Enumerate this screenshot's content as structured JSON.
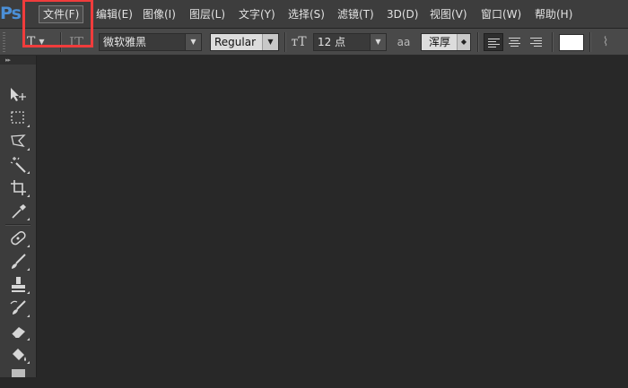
{
  "app": {
    "logo": "Ps"
  },
  "menubar": {
    "items": [
      {
        "label": "文件(F)"
      },
      {
        "label": "编辑(E)"
      },
      {
        "label": "图像(I)"
      },
      {
        "label": "图层(L)"
      },
      {
        "label": "文字(Y)"
      },
      {
        "label": "选择(S)"
      },
      {
        "label": "滤镜(T)"
      },
      {
        "label": "3D(D)"
      },
      {
        "label": "视图(V)"
      },
      {
        "label": "窗口(W)"
      },
      {
        "label": "帮助(H)"
      }
    ]
  },
  "options": {
    "font_family": "微软雅黑",
    "font_style": "Regular",
    "font_size": "12 点",
    "antialias_icon": "aa",
    "antialias": "浑厚",
    "text_color": "#ffffff"
  },
  "colors": {
    "highlight": "#f03c3c",
    "menubar_bg": "#3d3d3d",
    "optionsbar_bg": "#494949",
    "canvas_bg": "#282828"
  },
  "tools": [
    "move-tool-icon",
    "rectangular-marquee-icon",
    "lasso-icon",
    "magic-wand-icon",
    "crop-icon",
    "eyedropper-icon",
    "spot-healing-icon",
    "brush-icon",
    "clone-stamp-icon",
    "history-brush-icon",
    "eraser-icon",
    "paint-bucket-icon"
  ]
}
